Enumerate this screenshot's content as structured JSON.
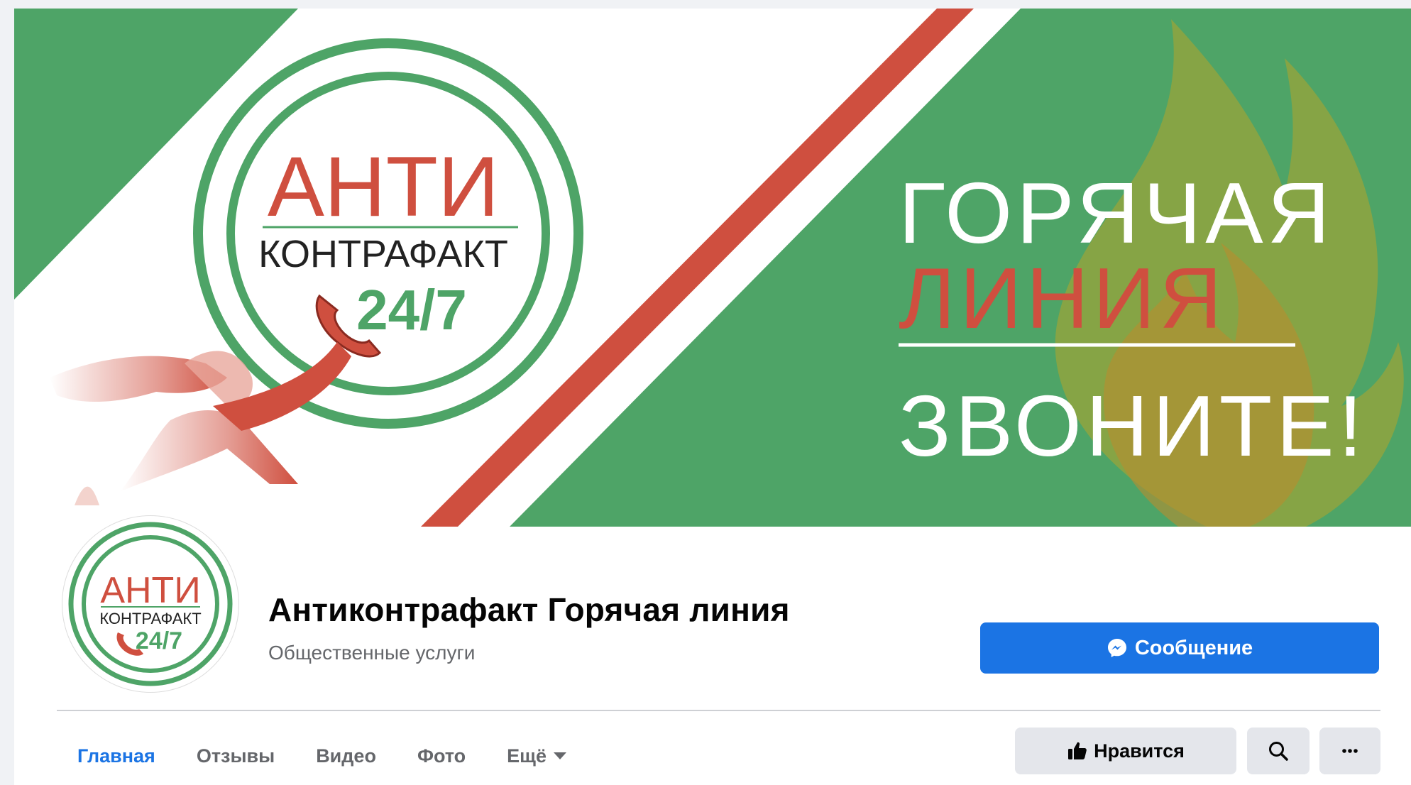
{
  "cover": {
    "logo_line1": "АНТИ",
    "logo_line2": "КОНТРАФАКТ",
    "logo_line3": "24/7",
    "headline_1": "ГОРЯЧАЯ",
    "headline_2": "ЛИНИЯ",
    "headline_3": "ЗВОНИТЕ!"
  },
  "avatar": {
    "logo_line1": "АНТИ",
    "logo_line2": "КОНТРАФАКТ",
    "logo_line3": "24/7"
  },
  "page": {
    "title": "Антиконтрафакт Горячая линия",
    "category": "Общественные услуги"
  },
  "actions": {
    "message_label": "Сообщение",
    "like_label": "Нравится"
  },
  "tabs": [
    {
      "label": "Главная",
      "active": true
    },
    {
      "label": "Отзывы"
    },
    {
      "label": "Видео"
    },
    {
      "label": "Фото"
    },
    {
      "label": "Ещё"
    }
  ],
  "colors": {
    "green": "#4ea467",
    "red": "#cf4f3f",
    "blue": "#1b74e4"
  }
}
